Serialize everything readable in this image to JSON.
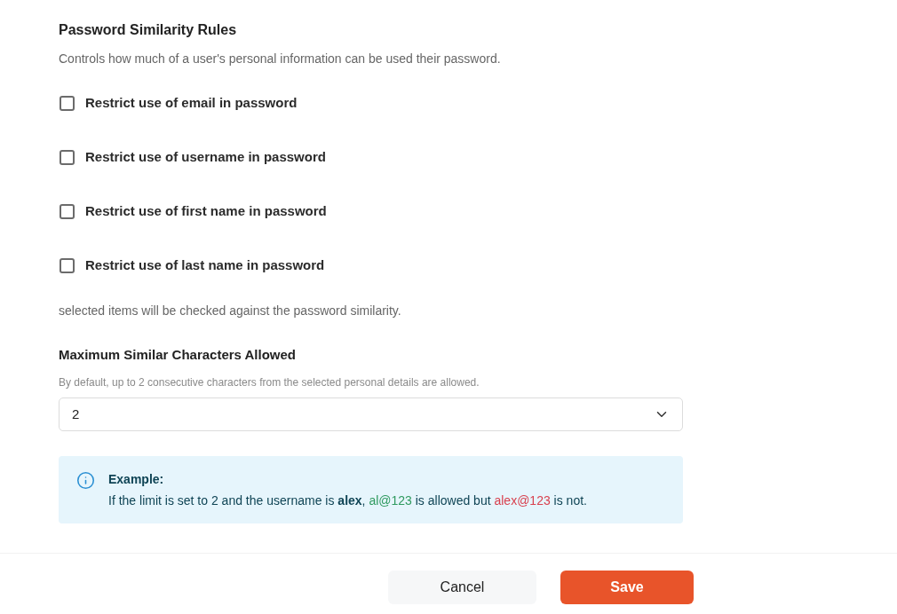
{
  "section": {
    "title": "Password Similarity Rules",
    "description": "Controls how much of a user's personal information can be used their password."
  },
  "rules": [
    {
      "label": "Restrict use of email in password",
      "checked": false
    },
    {
      "label": "Restrict use of username in password",
      "checked": false
    },
    {
      "label": "Restrict use of first name in password",
      "checked": false
    },
    {
      "label": "Restrict use of last name in password",
      "checked": false
    }
  ],
  "rules_note": "selected items will be checked against the password similarity.",
  "max_similar": {
    "label": "Maximum Similar Characters Allowed",
    "hint": "By default, up to 2 consecutive characters from the selected personal details are allowed.",
    "value": "2"
  },
  "example": {
    "title": "Example:",
    "segments": [
      {
        "kind": "plain",
        "text": "If the limit is set to 2 and the username is **alex**, "
      },
      {
        "kind": "allowed",
        "text": "al@123"
      },
      {
        "kind": "plain",
        "text": " is allowed but "
      },
      {
        "kind": "denied",
        "text": "alex@123"
      },
      {
        "kind": "plain",
        "text": " is not."
      }
    ]
  },
  "buttons": [
    {
      "kind": "secondary",
      "label": "Cancel"
    },
    {
      "kind": "primary",
      "label": "Save"
    }
  ]
}
